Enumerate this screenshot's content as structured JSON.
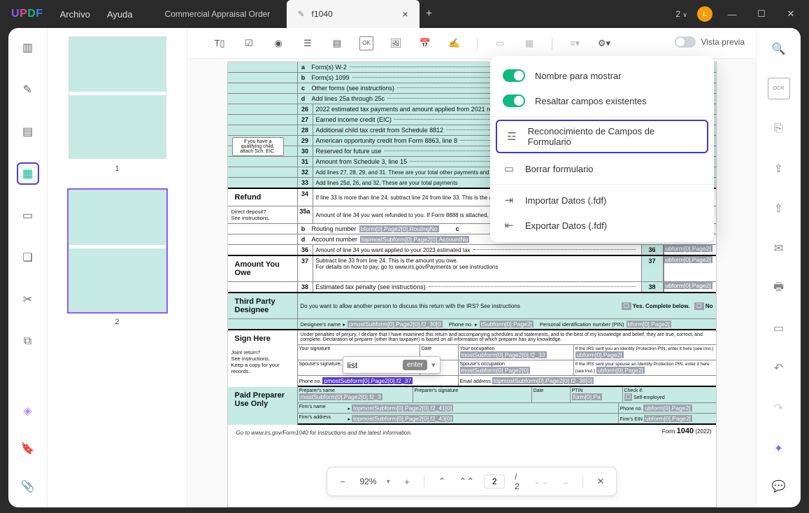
{
  "app": {
    "name_parts": [
      "U",
      "P",
      "D",
      "F"
    ]
  },
  "menus": {
    "file": "Archivo",
    "help": "Ayuda"
  },
  "tabs": {
    "inactive": "Commercial Appraisal Order",
    "active": "f1040"
  },
  "title_right": {
    "count": "2",
    "avatar": "L"
  },
  "preview": {
    "label": "Vista previa"
  },
  "thumbnails": {
    "p1": "1",
    "p2": "2"
  },
  "popup": {
    "show_name": "Nombre para mostrar",
    "highlight_fields": "Resaltar campos existentes",
    "recognize": "Reconocimiento de Campos de Formulario",
    "clear": "Borrar formulario",
    "import": "Importar Datos (.fdf)",
    "export": "Exportar Datos (.fdf)"
  },
  "doc": {
    "callout": "If you have a qualifying child, attach Sch. EIC.",
    "lines": {
      "a": "Form(s) W-2",
      "b": "Form(s) 1099",
      "c": "Other forms (see instructions)",
      "d": "Add lines 25a through 25c"
    },
    "num_lines": [
      {
        "n": "26",
        "t": "2022 estimated tax payments and amount applied from 2021 return"
      },
      {
        "n": "27",
        "t": "Earned income credit (EIC)"
      },
      {
        "n": "28",
        "t": "Additional child tax credit from Schedule 8812"
      },
      {
        "n": "29",
        "t": "American opportunity credit from Form 8863, line 8"
      },
      {
        "n": "30",
        "t": "Reserved for future use"
      },
      {
        "n": "31",
        "t": "Amount from Schedule 3, line 15"
      },
      {
        "n": "32",
        "t": "Add lines 27, 28, 29, and 31. These are your total other payments and refundable credits"
      },
      {
        "n": "33",
        "t": "Add lines 25d, 26, and 32. These are your total payments"
      }
    ],
    "refund": {
      "label": "Refund",
      "dd": "Direct deposit?",
      "see": "See instructions.",
      "l34": "If line 33 is more than line 24, subtract line 24 from line 33. This is the amount you overpaid",
      "l35a": "Amount of line 34 you want refunded to you. If Form 8888 is attached, check here",
      "routing": "Routing number",
      "routing_fld": "bform[0].Page2[0].RoutingNo",
      "type_c": "c",
      "account": "Account number",
      "account_fld": "topmostSubform[0].Page2[0].AccountNo",
      "l36": "Amount of line 34 you want applied to your 2023 estimated tax",
      "box36": "36",
      "fld36": "ubform[0].Page2["
    },
    "owe": {
      "label": "Amount You Owe",
      "l37": "Subtract line 33 from line 24. This is the amount you owe.",
      "l37b": "For details on how to pay, go to www.irs.gov/Payments or see instructions",
      "l38": "Estimated tax penalty (see instructions)",
      "box37": "37",
      "box38": "38",
      "fld37": "ubform[0].Page2[",
      "fld38": "ubform[0].Page2["
    },
    "third": {
      "label": "Third Party Designee",
      "q": "Do you want to allow another person to discuss this return with the IRS? See instructions",
      "yes": "Yes. Complete below.",
      "no": "No",
      "dname": "Designee's name",
      "phone": "Phone no.",
      "pin": "Personal identification number (PIN)",
      "f1": "pmostSubform[0].Page2[0].f2_30[0",
      "f2": "tSubform[0].Page2[",
      "f3": "bform[0].Page2["
    },
    "sign": {
      "label": "Sign Here",
      "jr": "Joint return?",
      "see": "See instructions.",
      "keep": "Keep a copy for your records.",
      "perjury": "Under penalties of perjury, I declare that I have examined this return and accompanying schedules and statements, and to the best of my knowledge and belief, they are true, correct, and complete. Declaration of preparer (other than taxpayer) is based on all information of which preparer has any knowledge.",
      "your_sig": "Your signature",
      "date": "Date",
      "occ": "Your occupation",
      "ip": "If the IRS sent you an Identity Protection PIN, enter it here (see inst.)",
      "sp_sig": "Spouse's signature. If a joint return, both must sign.",
      "sp_occ": "Spouse's occupation",
      "sp_ip": "If the IRS sent your spouse an Identity Protection PIN, enter it here (see inst.)",
      "phone": "Phone no.",
      "email": "Email address",
      "f_occ": "mostSubform[0].Page2[0].f2_33",
      "f_ip": "ubform[0].Page2[",
      "f_socc": "mostSubform[0].Page2[0]",
      "f_sip": "ubform[0].Page2[",
      "f_phone": "pmostSubform[0].Page2[0].f2_37",
      "f_email": "topmostSubform[0].Page2[0].f2_38[0]"
    },
    "paid": {
      "label": "Paid Preparer Use Only",
      "pname": "Preparer's name",
      "psig": "Preparer's signature",
      "date": "Date",
      "ptin": "PTIN",
      "check": "Check if:",
      "self": "Self-employed",
      "fname": "Firm's name",
      "faddr": "Firm's address",
      "fphone": "Phone no.",
      "fein": "Firm's EIN",
      "f1": "mostSubform[0].Page2[0].f2_3",
      "f2": "form[0].Pa",
      "f3": "topmostSubform[0].Page2[0].f2_41[0]",
      "f4": "ubform[0].Page2[",
      "f5": "topmostSubform[0].Page2[0].f2_43[0]",
      "f6": "ubform[0].Page2["
    },
    "footer": "Go to www.irs.gov/Form1040 for instructions and the latest information.",
    "form_no": "1040",
    "year": "(2022)",
    "form_word": "Form"
  },
  "mini_dd": {
    "text": "list",
    "enter": "enter"
  },
  "pager": {
    "zoom": "92%",
    "page": "2",
    "total": "/  2"
  }
}
